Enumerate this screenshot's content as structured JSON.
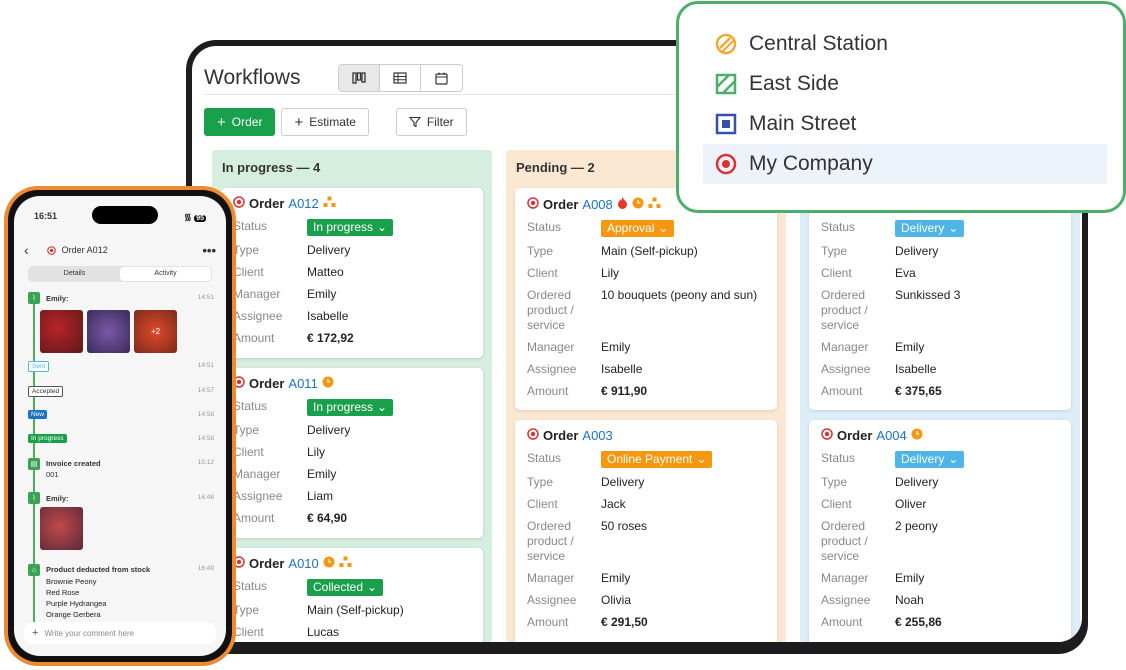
{
  "workflow": {
    "title": "Workflows",
    "buttons": {
      "order": "Order",
      "estimate": "Estimate",
      "filter": "Filter"
    },
    "columns": [
      {
        "name": "In progress — 4"
      },
      {
        "name": "Pending — 2"
      }
    ],
    "labels": {
      "status": "Status",
      "type": "Type",
      "client": "Client",
      "manager": "Manager",
      "assignee": "Assignee",
      "amount": "Amount",
      "ordered1": "Ordered",
      "ordered2": "product /",
      "ordered3": "service"
    },
    "cards": {
      "a012": {
        "title": "Order",
        "num": "A012",
        "status": "In progress",
        "type": "Delivery",
        "client": "Matteo",
        "manager": "Emily",
        "assignee": "Isabelle",
        "amount": "€ 172,92"
      },
      "a011": {
        "title": "Order",
        "num": "A011",
        "status": "In progress",
        "type": "Delivery",
        "client": "Lily",
        "manager": "Emily",
        "assignee": "Liam",
        "amount": "€ 64,90"
      },
      "a010": {
        "title": "Order",
        "num": "A010",
        "status": "Collected",
        "type": "Main (Self-pickup)",
        "client": "Lucas"
      },
      "a008": {
        "title": "Order",
        "num": "A008",
        "status": "Approval",
        "type": "Main (Self-pickup)",
        "client": "Lily",
        "product": "10 bouquets (peony and sun)",
        "manager": "Emily",
        "assignee": "Isabelle",
        "amount": "€ 911,90"
      },
      "a003": {
        "title": "Order",
        "num": "A003",
        "status": "Online Payment",
        "type": "Delivery",
        "client": "Jack",
        "product": "50 roses",
        "manager": "Emily",
        "assignee": "Olivia",
        "amount": "€ 291,50"
      },
      "b1": {
        "status": "Delivery",
        "type": "Delivery",
        "client": "Eva",
        "product": "Sunkissed 3",
        "manager": "Emily",
        "assignee": "Isabelle",
        "amount": "€ 375,65"
      },
      "a004": {
        "title": "Order",
        "num": "A004",
        "status": "Delivery",
        "type": "Delivery",
        "client": "Oliver",
        "product": "2 peony",
        "manager": "Emily",
        "assignee": "Noah",
        "amount": "€ 255,86"
      }
    }
  },
  "locations": [
    {
      "label": "Central Station",
      "icon": "striped-circle-icon",
      "color": "#f0a830"
    },
    {
      "label": "East Side",
      "icon": "striped-square-icon",
      "color": "#4cae6a"
    },
    {
      "label": "Main Street",
      "icon": "square-dot-icon",
      "color": "#3a4fa8"
    },
    {
      "label": "My Company",
      "icon": "target-icon",
      "color": "#d93434"
    }
  ],
  "phone": {
    "time": "16:51",
    "battery": "95",
    "title": "Order A012",
    "tabs": {
      "details": "Details",
      "activity": "Activity"
    },
    "events": {
      "emily1": "Emily:",
      "t1": "14:51",
      "more": "+2",
      "sent": "Sent",
      "t2": "14:51",
      "accepted": "Accepted",
      "t3": "14:57",
      "new": "New",
      "t4": "14:58",
      "inprogress": "In progress",
      "t5": "14:58",
      "invoice": "Invoice created",
      "invoice_no": "001",
      "t6": "15:12",
      "emily2": "Emily:",
      "t7": "16:48",
      "stock": "Product deducted from stock",
      "t8": "16:49",
      "items": [
        "Brownie Peony",
        "Red Rose",
        "Purple Hydrangea",
        "Orange Gerbera"
      ]
    },
    "comment_placeholder": "Write your comment here"
  },
  "colors": {
    "green": "#19a04b",
    "orange": "#f5970f",
    "blue": "#4fb4e6",
    "link": "#1a73c8",
    "accent_border": "#4cae6a",
    "phone_frame": "#ef8a2e"
  }
}
